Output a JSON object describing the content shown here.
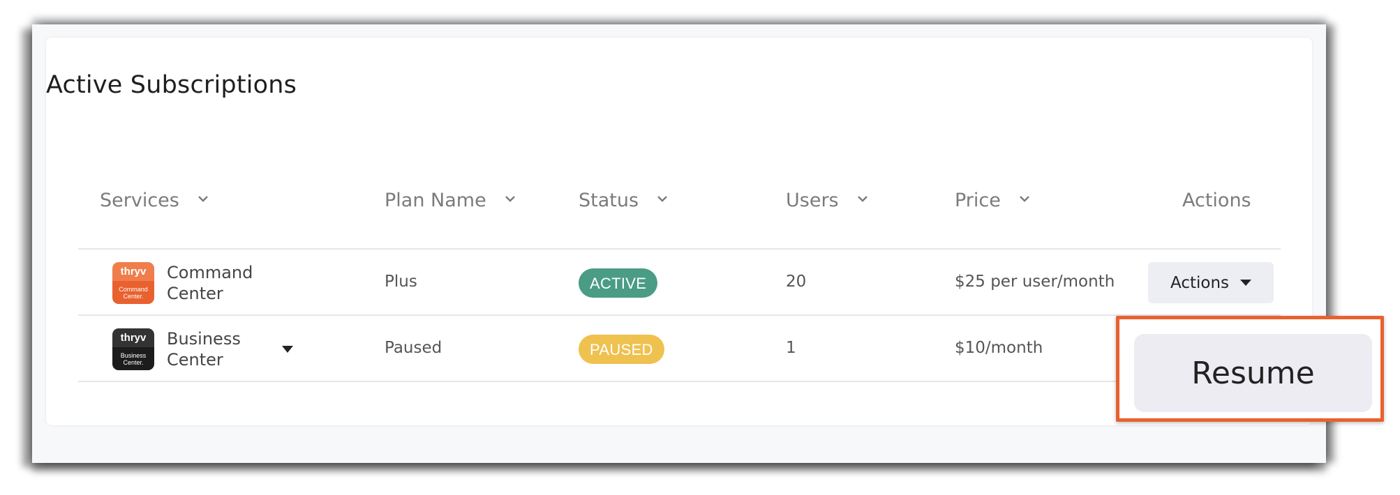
{
  "page": {
    "title": "Active Subscriptions"
  },
  "table": {
    "columns": [
      {
        "label": "Services",
        "sortable": true
      },
      {
        "label": "Plan Name",
        "sortable": true
      },
      {
        "label": "Status",
        "sortable": true
      },
      {
        "label": "Users",
        "sortable": true
      },
      {
        "label": "Price",
        "sortable": true
      },
      {
        "label": "Actions",
        "sortable": false
      }
    ],
    "rows": [
      {
        "service_line1": "Command",
        "service_line2": "Center",
        "logo_top": "thryv",
        "logo_line1": "Command",
        "logo_line2": "Center.",
        "logo_color": "#e8612e",
        "plan": "Plus",
        "status": "ACTIVE",
        "status_color": "#4a9c84",
        "users": "20",
        "price": "$25 per user/month",
        "action_label": "Actions",
        "expanded_caret": false
      },
      {
        "service_line1": "Business",
        "service_line2": "Center",
        "logo_top": "thryv",
        "logo_line1": "Business",
        "logo_line2": "Center.",
        "logo_color": "#1c1c1c",
        "plan": "Paused",
        "status": "PAUSED",
        "status_color": "#efc14f",
        "users": "1",
        "price": "$10/month",
        "expanded_caret": true
      }
    ]
  },
  "dropdown": {
    "resume_label": "Resume",
    "highlight_color": "#e8612e"
  }
}
